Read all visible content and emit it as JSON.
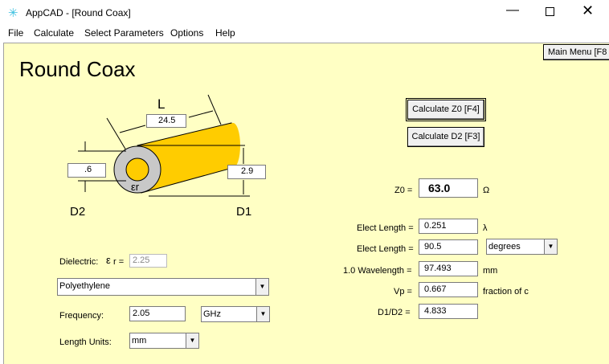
{
  "window": {
    "title": "AppCAD - [Round Coax]"
  },
  "menu": [
    "File",
    "Calculate",
    "Select Parameters",
    "Options",
    "Help"
  ],
  "main_menu_button": "Main Menu [F8",
  "page_title": "Round Coax",
  "diagram": {
    "L_label": "L",
    "L_value": "24.5",
    "D2_label": "D2",
    "D2_value": ".6",
    "D1_label": "D1",
    "D1_value": "2.9",
    "er_label": "εr"
  },
  "buttons": {
    "calc_z0": "Calculate Z0  [F4]",
    "calc_d2": "Calculate D2  [F3]"
  },
  "results": {
    "z0": {
      "label": "Z0 =",
      "value": "63.0",
      "unit": "Ω"
    },
    "elect_length_lambda": {
      "label": "Elect Length =",
      "value": "0.251",
      "unit": "λ"
    },
    "elect_length_deg": {
      "label": "Elect Length =",
      "value": "90.5",
      "unit": "degrees"
    },
    "wavelength": {
      "label": "1.0 Wavelength =",
      "value": "97.493",
      "unit": "mm"
    },
    "vp": {
      "label": "Vp =",
      "value": "0.667",
      "unit": "fraction of c"
    },
    "ratio": {
      "label": "D1/D2 =",
      "value": "4.833"
    }
  },
  "inputs": {
    "dielectric_label": "Dielectric:",
    "er_symbol": "ε",
    "er_eq": "r =",
    "er_value": "2.25",
    "material": "Polyethylene",
    "frequency_label": "Frequency:",
    "frequency_value": "2.05",
    "frequency_unit": "GHz",
    "length_units_label": "Length Units:",
    "length_units": "mm"
  },
  "colors": {
    "panel": "#ffffc4",
    "conductor": "#ffcc00",
    "dielectric": "#c8c8c8"
  }
}
